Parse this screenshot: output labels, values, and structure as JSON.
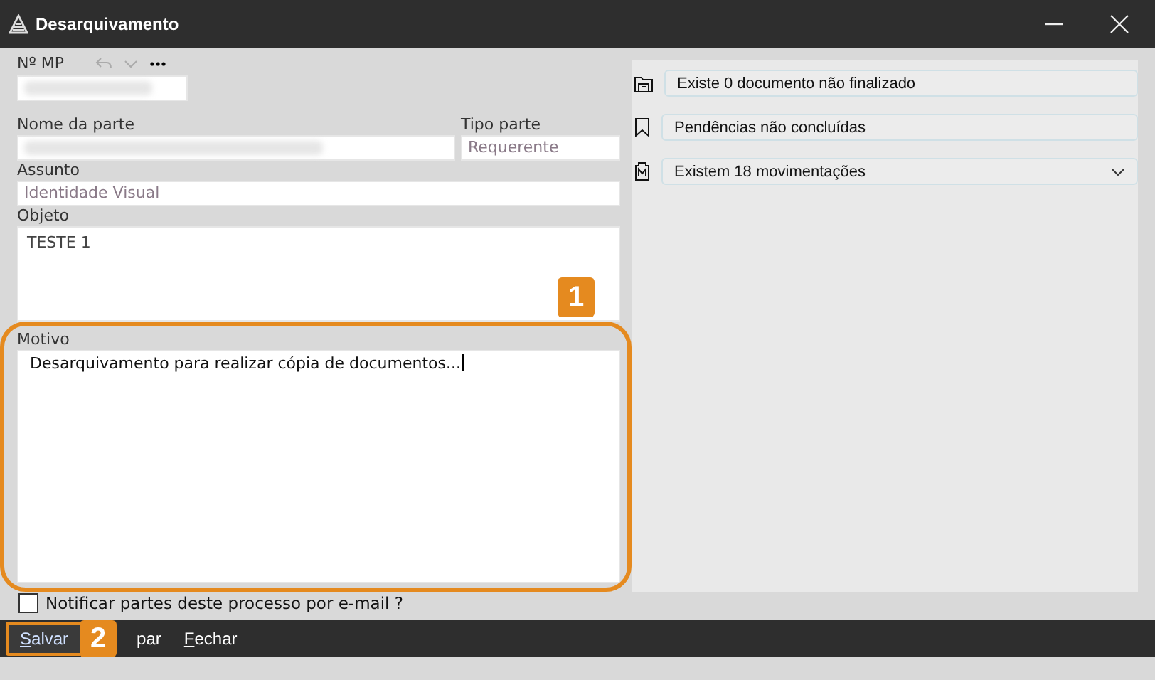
{
  "window": {
    "title": "Desarquivamento"
  },
  "form": {
    "mp_label": "Nº MP",
    "nome_label": "Nome da parte",
    "tipo_label": "Tipo parte",
    "tipo_value": "Requerente",
    "assunto_label": "Assunto",
    "assunto_value": "Identidade Visual",
    "objeto_label": "Objeto",
    "objeto_value": "TESTE 1",
    "motivo_label": "Motivo",
    "motivo_value": "Desarquivamento para realizar cópia de documentos..."
  },
  "info_items": [
    {
      "kind": "folder",
      "text": "Existe 0 documento não finalizado",
      "expandable": false
    },
    {
      "kind": "bookmark",
      "text": "Pendências não concluídas",
      "expandable": false
    },
    {
      "kind": "doc",
      "text": "Existem 18 movimentações",
      "expandable": true
    }
  ],
  "notify": {
    "label": "Notificar partes deste processo por e-mail ?",
    "checked": false
  },
  "buttons": [
    {
      "label": "Salvar",
      "mnemonic": true,
      "selected": true
    },
    {
      "label": "par",
      "mnemonic": false,
      "selected": false
    },
    {
      "label": "Fechar",
      "mnemonic": true,
      "selected": false
    }
  ],
  "callouts": [
    "1",
    "2"
  ]
}
